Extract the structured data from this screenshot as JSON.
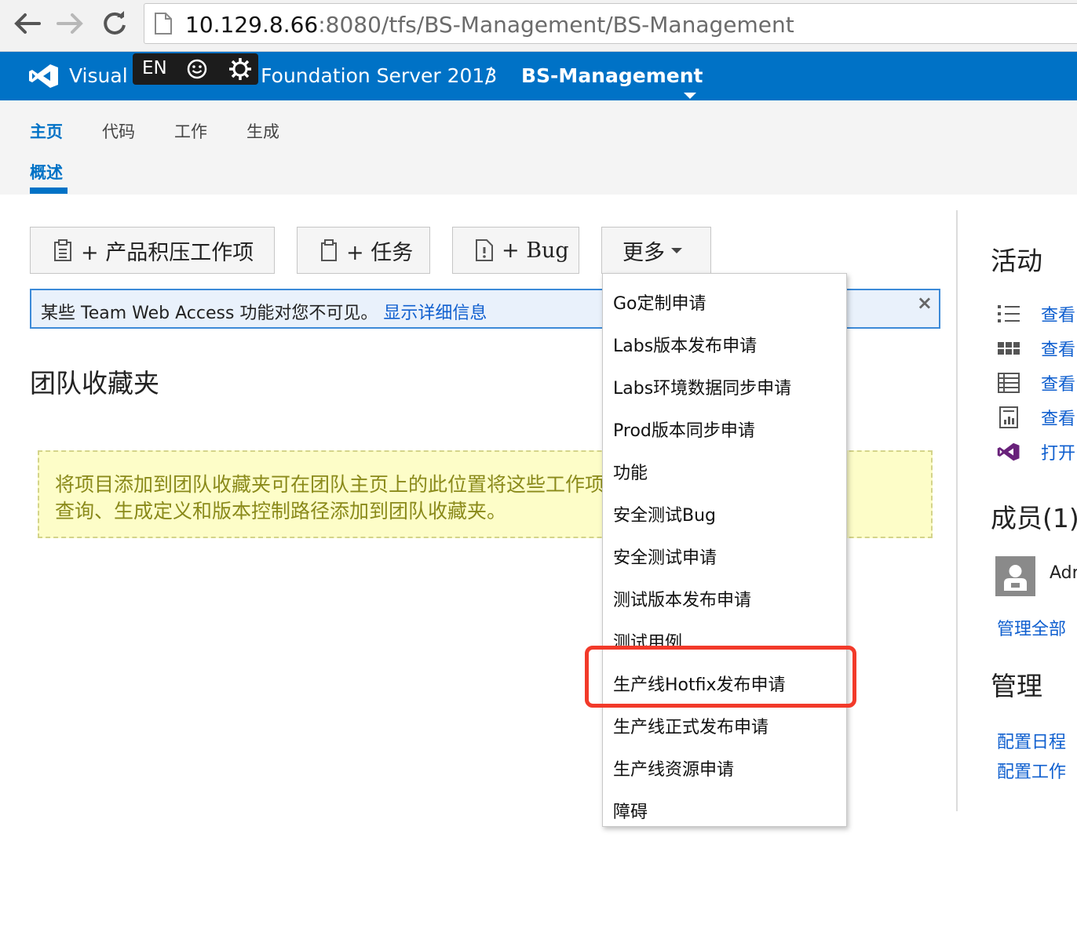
{
  "browser": {
    "url_host": "10.129.8.66",
    "url_path": ":8080/tfs/BS-Management/BS-Management"
  },
  "header": {
    "product_name": "Visual Studio Team Foundation Server 2013",
    "separator": "/",
    "project_name": "BS-Management",
    "brand_color": "#0072c6"
  },
  "ime": {
    "language": "EN"
  },
  "hub_tabs": [
    {
      "label": "主页",
      "active": true
    },
    {
      "label": "代码",
      "active": false
    },
    {
      "label": "工作",
      "active": false
    },
    {
      "label": "生成",
      "active": false
    }
  ],
  "sub_tab": {
    "label": "概述"
  },
  "toolbar": {
    "new_backlog_item": "+ 产品积压工作项",
    "new_task": "+ 任务",
    "new_bug": "+ Bug",
    "more": "更多"
  },
  "info_banner": {
    "text": "某些 Team Web Access 功能对您不可见。",
    "link": "显示详细信息",
    "close": "×"
  },
  "favorites": {
    "title": "团队收藏夹",
    "line1": "将项目添加到团队收藏夹可在团队主页上的此位置将这些工作项",
    "line2": "查询、生成定义和版本控制路径添加到团队收藏夹。"
  },
  "more_menu": {
    "items": [
      "Go定制申请",
      "Labs版本发布申请",
      "Labs环境数据同步申请",
      "Prod版本同步申请",
      "功能",
      "安全测试Bug",
      "安全测试申请",
      "测试版本发布申请",
      "测试用例",
      "生产线Hotfix发布申请",
      "生产线正式发布申请",
      "生产线资源申请",
      "障碍"
    ],
    "highlighted": "生产线Hotfix发布申请",
    "highlight_color": "#f23a2a"
  },
  "side_panel": {
    "activity_title": "活动",
    "activity_items": [
      {
        "icon": "list-icon",
        "label": "查看"
      },
      {
        "icon": "board-icon",
        "label": "查看"
      },
      {
        "icon": "grid-icon",
        "label": "查看"
      },
      {
        "icon": "report-icon",
        "label": "查看"
      },
      {
        "icon": "visual-studio-icon",
        "label": "打开"
      }
    ],
    "members_title": "成员(1)",
    "member_name": "Adr",
    "manage_members": "管理全部",
    "admin_title": "管理",
    "admin_links": [
      "配置日程",
      "配置工作"
    ]
  }
}
